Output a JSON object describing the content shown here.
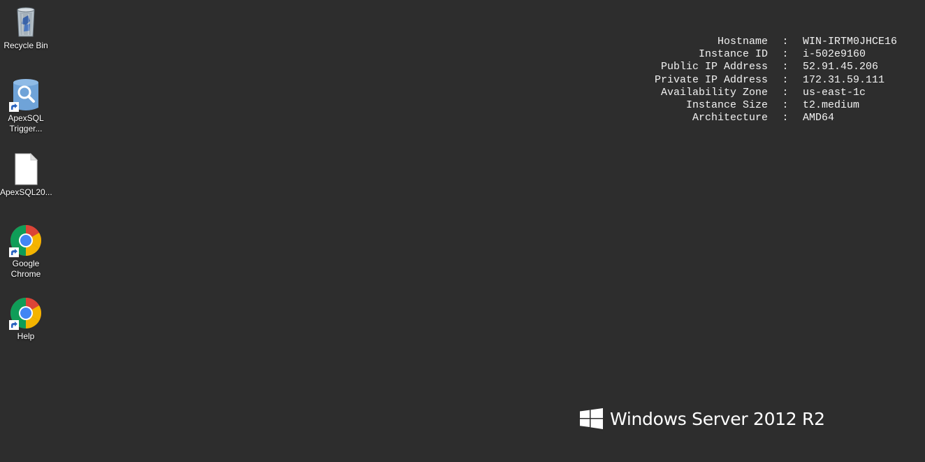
{
  "desktop_icons": [
    {
      "label": "Recycle Bin",
      "icon": "recycle-bin-icon"
    },
    {
      "label": "ApexSQL\nTrigger...",
      "icon": "apexsql-search-icon"
    },
    {
      "label": "ApexSQL20...",
      "icon": "blank-file-icon"
    },
    {
      "label": "Google\nChrome",
      "icon": "chrome-icon"
    },
    {
      "label": "Help",
      "icon": "chrome-icon"
    }
  ],
  "instance_info": [
    {
      "label": "Hostname",
      "sep": ":",
      "value": "WIN-IRTM0JHCE16"
    },
    {
      "label": "Instance ID",
      "sep": ":",
      "value": "i-502e9160"
    },
    {
      "label": "Public IP Address",
      "sep": ":",
      "value": "52.91.45.206"
    },
    {
      "label": "Private IP Address",
      "sep": ":",
      "value": "172.31.59.111"
    },
    {
      "label": "Availability Zone",
      "sep": ":",
      "value": "us-east-1c"
    },
    {
      "label": "Instance Size",
      "sep": ":",
      "value": "t2.medium"
    },
    {
      "label": "Architecture",
      "sep": ":",
      "value": "AMD64"
    }
  ],
  "branding": {
    "text": "Windows Server 2012 R2",
    "logo": "windows-logo-icon"
  },
  "colors": {
    "background": "#2d2d2d",
    "text": "#f2f2f2",
    "chrome_red": "#db4437",
    "chrome_green": "#0f9d58",
    "chrome_yellow": "#f4b400",
    "chrome_blue": "#4285f4"
  }
}
